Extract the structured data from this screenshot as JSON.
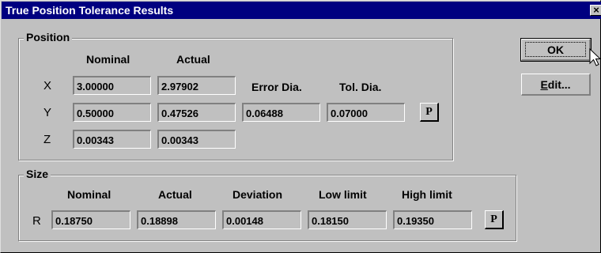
{
  "window": {
    "title": "True Position Tolerance Results",
    "close_glyph": "×"
  },
  "position": {
    "legend": "Position",
    "headers": {
      "nominal": "Nominal",
      "actual": "Actual",
      "error_dia": "Error Dia.",
      "tol_dia": "Tol. Dia."
    },
    "rows": [
      {
        "axis": "X",
        "nominal": "3.00000",
        "actual": "2.97902"
      },
      {
        "axis": "Y",
        "nominal": "0.50000",
        "actual": "0.47526"
      },
      {
        "axis": "Z",
        "nominal": "0.00343",
        "actual": "0.00343"
      }
    ],
    "error_dia": "0.06488",
    "tol_dia": "0.07000",
    "p_button": "P"
  },
  "size": {
    "legend": "Size",
    "headers": {
      "nominal": "Nominal",
      "actual": "Actual",
      "deviation": "Deviation",
      "low_limit": "Low limit",
      "high_limit": "High limit"
    },
    "axis": "R",
    "nominal": "0.18750",
    "actual": "0.18898",
    "deviation": "0.00148",
    "low_limit": "0.18150",
    "high_limit": "0.19350",
    "p_button": "P"
  },
  "buttons": {
    "ok": "OK",
    "edit_prefix": "E",
    "edit_rest": "dit..."
  },
  "icons": {
    "cursor": "arrow-cursor-icon"
  }
}
